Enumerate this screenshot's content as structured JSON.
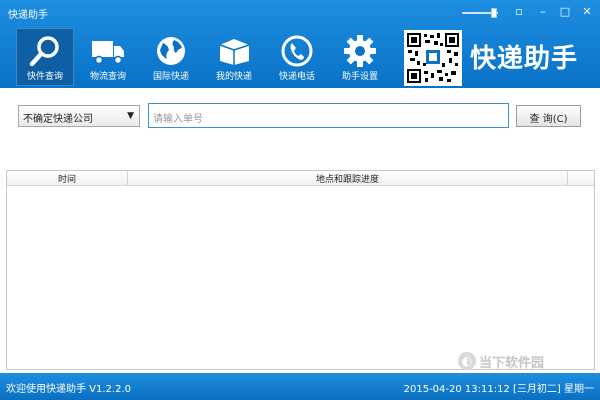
{
  "window": {
    "title": "快递助手",
    "minimize": "–",
    "maximize": "□",
    "close": "✕",
    "skin_icon": "▫"
  },
  "nav": [
    {
      "label": "快件查询",
      "icon": "search-icon"
    },
    {
      "label": "物流查询",
      "icon": "truck-icon"
    },
    {
      "label": "国际快递",
      "icon": "globe-icon"
    },
    {
      "label": "我的快递",
      "icon": "package-icon"
    },
    {
      "label": "快递电话",
      "icon": "phone-icon"
    },
    {
      "label": "助手设置",
      "icon": "gear-icon"
    }
  ],
  "brand": "快递助手",
  "search": {
    "company_selected": "不确定快递公司",
    "tracking_placeholder": "请输入单号",
    "query_label": "查 询(C)"
  },
  "table": {
    "col_time": "时间",
    "col_progress": "地点和跟踪进度"
  },
  "watermark": "当下软件园",
  "status": {
    "left": "欢迎使用快递助手 V1.2.2.0",
    "right": "2015-04-20 13:11:12 [三月初二] 星期一"
  },
  "colors": {
    "header": "#0a72c6",
    "active_tab": "#0f5fa5",
    "input_border": "#3d8fd6"
  }
}
